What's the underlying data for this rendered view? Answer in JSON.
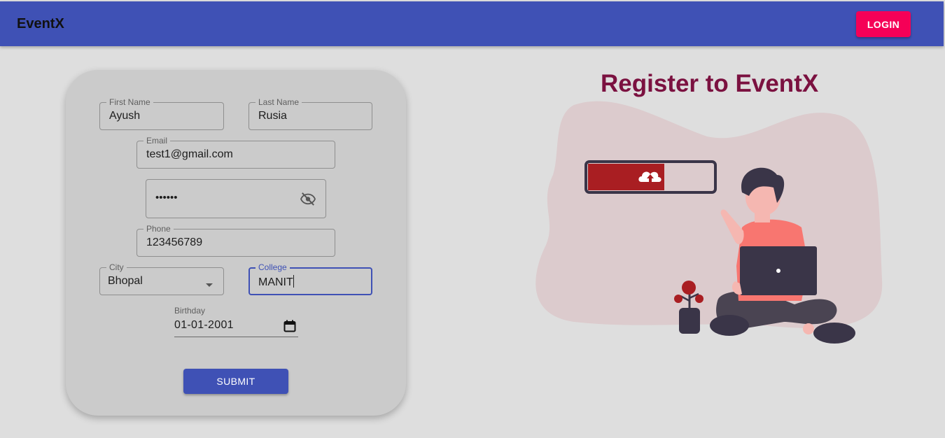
{
  "app": {
    "brand": "EventX",
    "login_label": "LOGIN"
  },
  "form": {
    "first_name": {
      "label": "First Name",
      "value": "Ayush"
    },
    "last_name": {
      "label": "Last Name",
      "value": "Rusia"
    },
    "email": {
      "label": "Email",
      "value": "test1@gmail.com"
    },
    "password": {
      "value": "••••••",
      "icon": "visibility-off-icon"
    },
    "phone": {
      "label": "Phone",
      "value": "123456789"
    },
    "city": {
      "label": "City",
      "value": "Bhopal"
    },
    "college": {
      "label": "College",
      "value": "MANIT"
    },
    "birthday": {
      "label": "Birthday",
      "value": "01-01-2001"
    },
    "submit_label": "SUBMIT"
  },
  "hero": {
    "headline": "Register to EventX"
  },
  "colors": {
    "appbar": "#3f51b5",
    "login_button": "#f50057",
    "headline": "#7b1140",
    "accent_red": "#a91e22",
    "blob": "#dccbcd"
  }
}
